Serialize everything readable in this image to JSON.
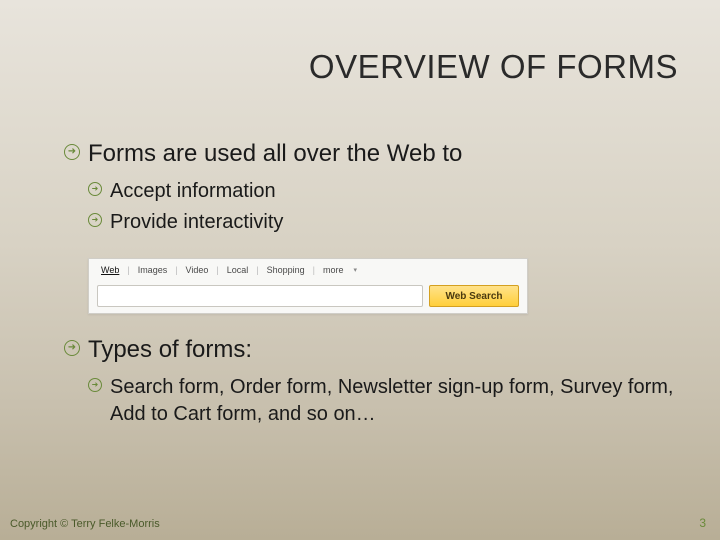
{
  "title": "OVERVIEW OF FORMS",
  "bullets": {
    "main1": "Forms are used all over the Web to",
    "sub1a": "Accept information",
    "sub1b": "Provide interactivity",
    "main2": "Types of forms:",
    "sub2a": "Search form, Order form, Newsletter sign-up form, Survey form,  Add to Cart form, and so on…"
  },
  "search_widget": {
    "tabs": {
      "web": "Web",
      "images": "Images",
      "video": "Video",
      "local": "Local",
      "shopping": "Shopping",
      "more": "more"
    },
    "button": "Web Search"
  },
  "footer": "Copyright © Terry Felke-Morris",
  "page_number": "3"
}
